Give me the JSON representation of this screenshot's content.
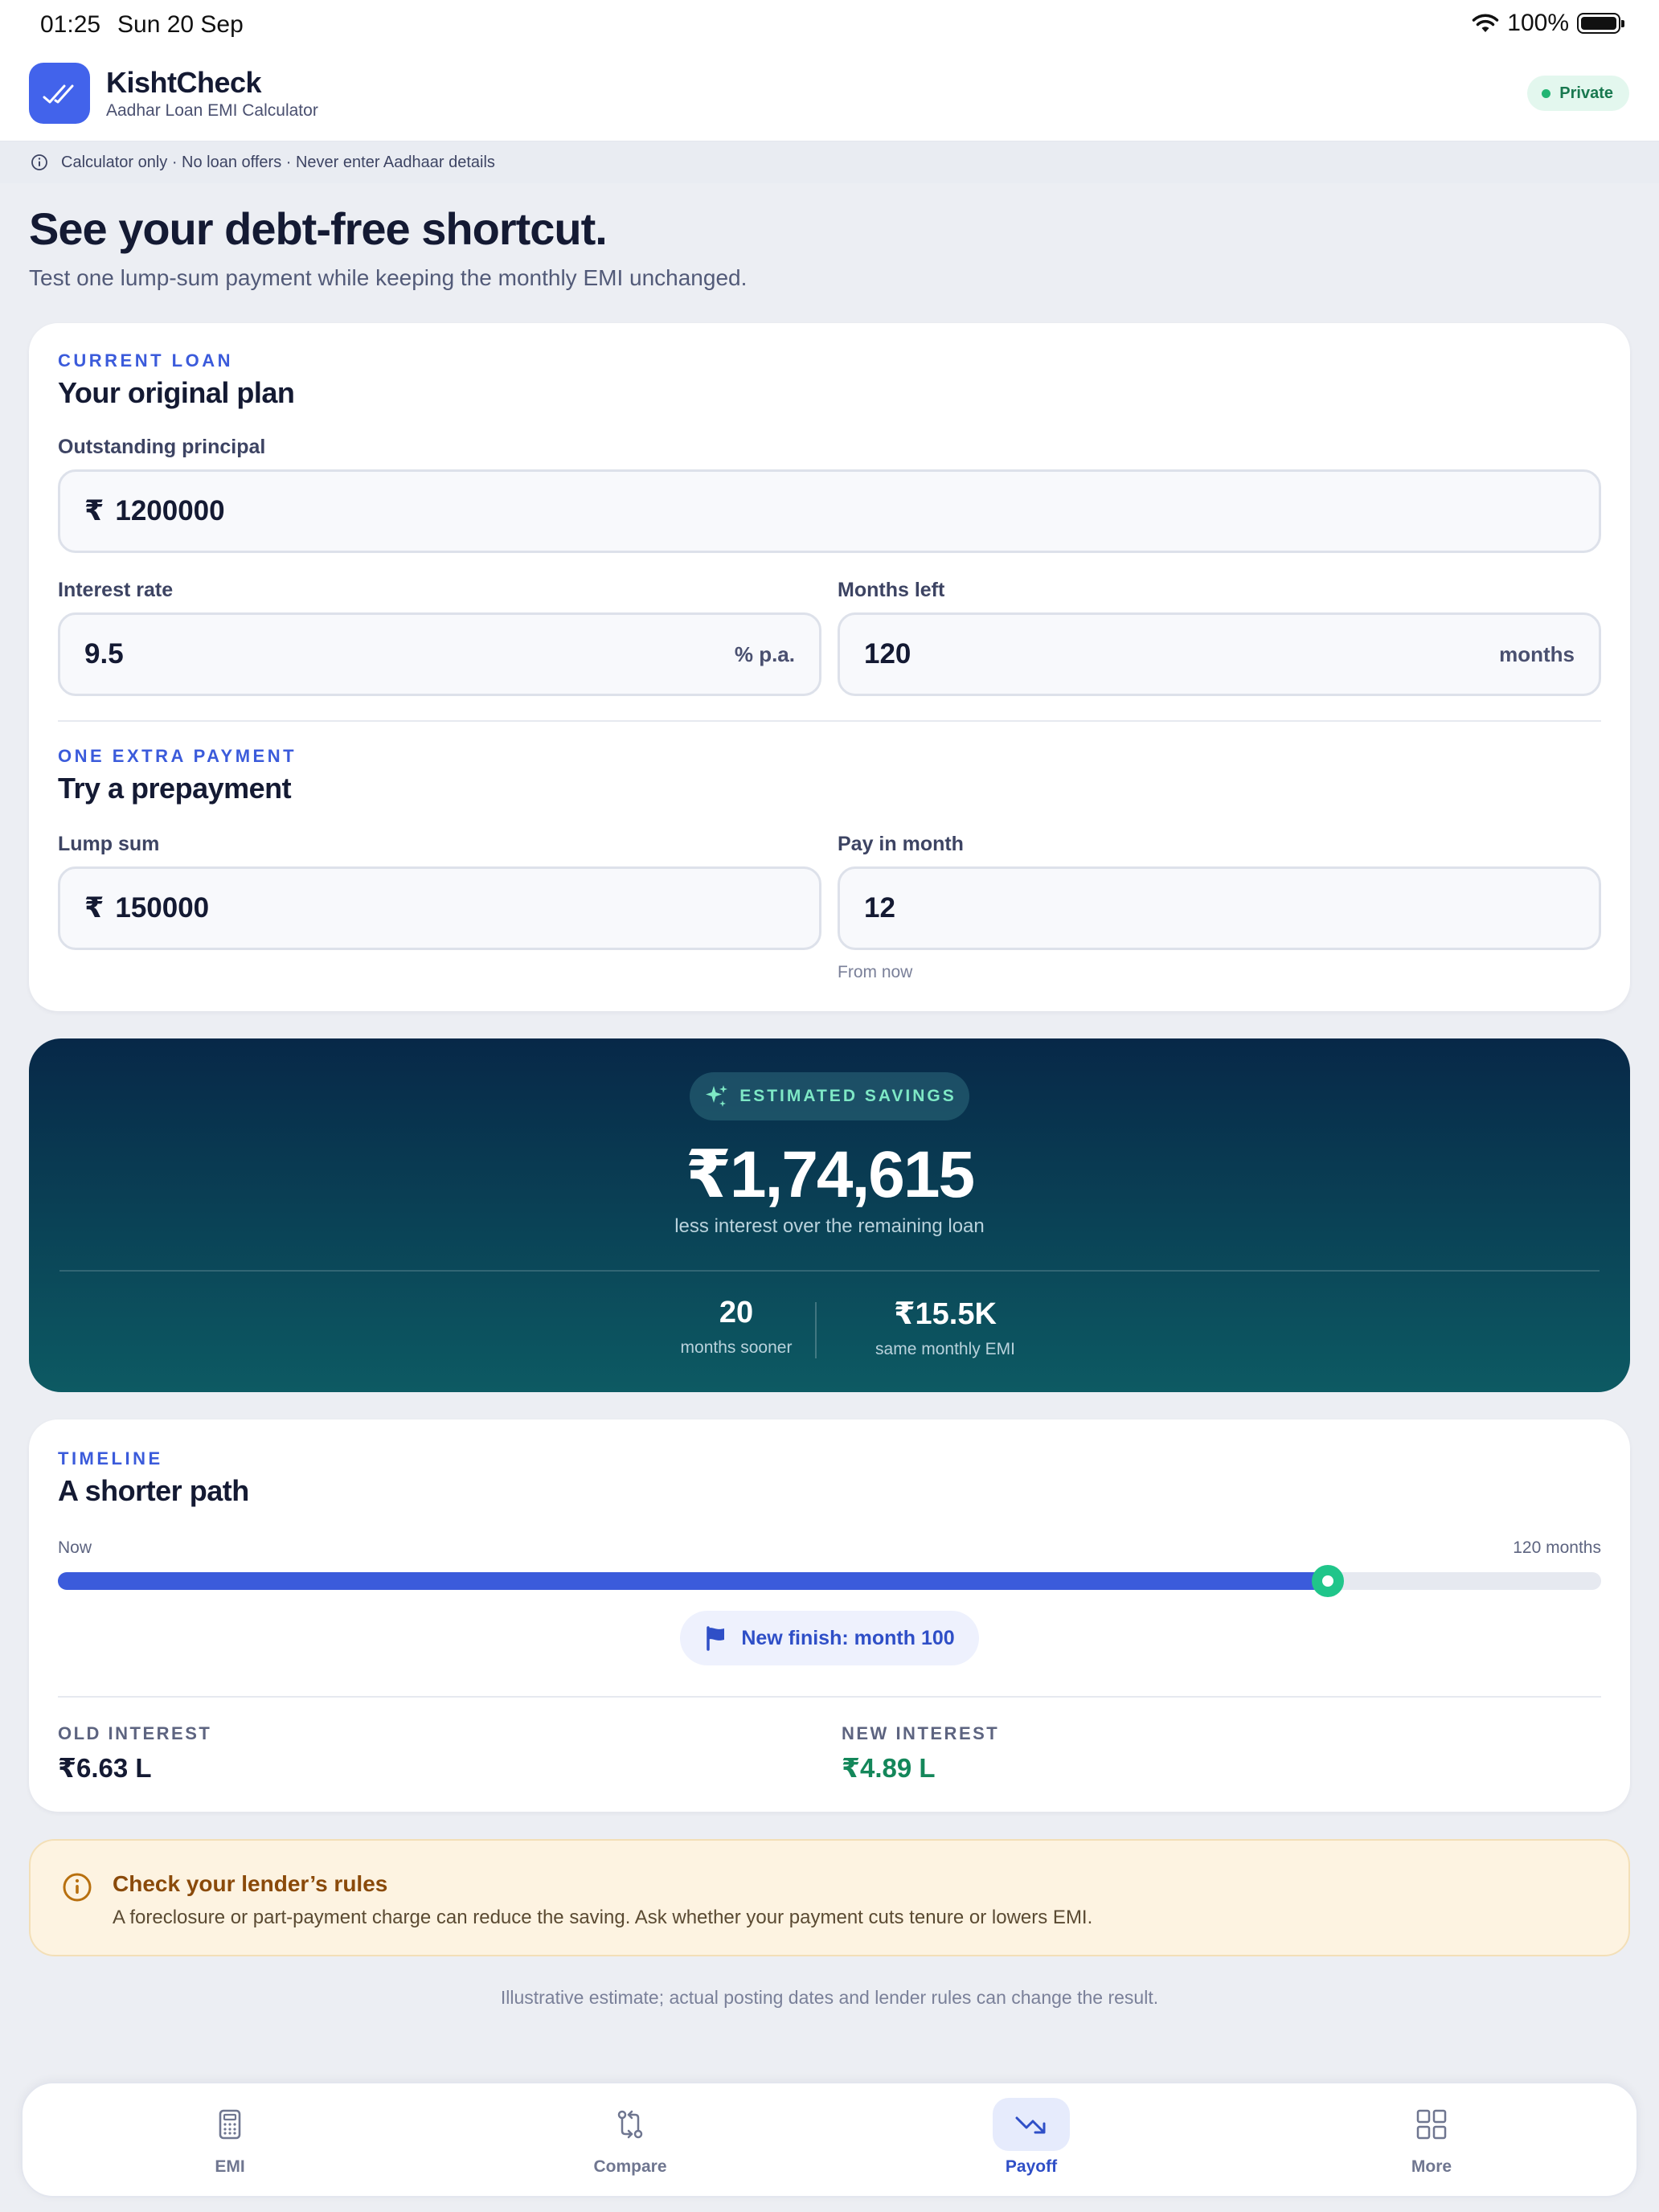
{
  "status_bar": {
    "time": "01:25",
    "date": "Sun 20 Sep",
    "battery": "100%"
  },
  "app": {
    "name": "KishtCheck",
    "subtitle": "Aadhar Loan EMI Calculator",
    "badge": "Private"
  },
  "notice": "Calculator only · No loan offers · Never enter Aadhaar details",
  "hero": {
    "title": "See your debt-free shortcut.",
    "subtitle": "Test one lump-sum payment while keeping the monthly EMI unchanged."
  },
  "current_loan": {
    "eyebrow": "CURRENT LOAN",
    "title": "Your original plan",
    "principal": {
      "label": "Outstanding principal",
      "currency": "₹",
      "value": "1200000"
    },
    "rate": {
      "label": "Interest rate",
      "value": "9.5",
      "unit": "% p.a."
    },
    "months": {
      "label": "Months left",
      "value": "120",
      "unit": "months"
    }
  },
  "prepayment": {
    "eyebrow": "ONE EXTRA PAYMENT",
    "title": "Try a prepayment",
    "lump_sum": {
      "label": "Lump sum",
      "currency": "₹",
      "value": "150000"
    },
    "pay_month": {
      "label": "Pay in month",
      "value": "12",
      "hint": "From now"
    }
  },
  "savings": {
    "label": "ESTIMATED SAVINGS",
    "amount": "₹1,74,615",
    "caption": "less interest over the remaining loan",
    "months_sooner": {
      "value": "20",
      "label": "months sooner"
    },
    "emi": {
      "value": "₹15.5K",
      "label": "same monthly EMI"
    }
  },
  "timeline": {
    "eyebrow": "TIMELINE",
    "title": "A shorter path",
    "start_label": "Now",
    "end_label": "120 months",
    "progress_fraction": 0.823,
    "finish_label": "New finish: month 100",
    "old_interest": {
      "label": "OLD INTEREST",
      "value": "₹6.63 L"
    },
    "new_interest": {
      "label": "NEW INTEREST",
      "value": "₹4.89 L"
    }
  },
  "warning": {
    "title": "Check your lender’s rules",
    "body": "A foreclosure or part-payment charge can reduce the saving. Ask whether your payment cuts tenure or lowers EMI."
  },
  "footnote": "Illustrative estimate; actual posting dates and lender rules can change the result.",
  "tabs": [
    {
      "label": "EMI",
      "icon": "calculator-icon",
      "active": false
    },
    {
      "label": "Compare",
      "icon": "compare-icon",
      "active": false
    },
    {
      "label": "Payoff",
      "icon": "trending-down-icon",
      "active": true
    },
    {
      "label": "More",
      "icon": "grid-icon",
      "active": false
    }
  ],
  "colors": {
    "accent": "#3b5bdb",
    "success": "#20c58a",
    "savings_bg_top": "#072848",
    "savings_bg_bottom": "#0d5a63",
    "warning_bg": "#fdf3e1"
  }
}
